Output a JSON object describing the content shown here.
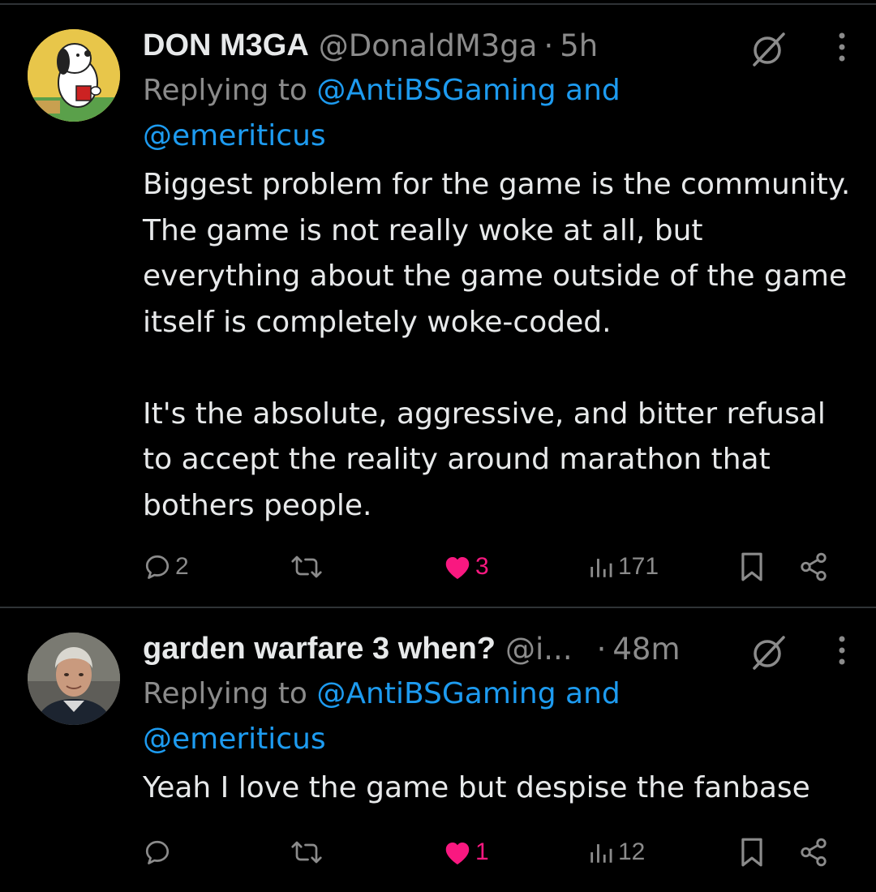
{
  "tweets": [
    {
      "name": "DON M3GA",
      "handle": "@DonaldM3ga",
      "separator": "·",
      "time": "5h",
      "reply_prefix": "Replying to ",
      "reply_mention_1": "@AntiBSGaming",
      "reply_and": " and",
      "reply_mention_2": "@emeriticus",
      "body": "Biggest problem for the game is the community. The game is not really woke at all, but everything about the game outside of the game itself is completely woke-coded.\n\nIt's the absolute, aggressive, and bitter refusal to accept the reality around marathon that bothers people.",
      "reply_count": "2",
      "retweet_count": "",
      "like_count": "3",
      "view_count": "171",
      "liked": true,
      "avatar_icon": "snoopy-avatar"
    },
    {
      "name": "garden warfare 3 when?",
      "handle": "@i...",
      "separator": "·",
      "time": "48m",
      "reply_prefix": "Replying to ",
      "reply_mention_1": "@AntiBSGaming",
      "reply_and": " and",
      "reply_mention_2": "@emeriticus",
      "body": "Yeah I love the game but despise the fanbase",
      "reply_count": "",
      "retweet_count": "",
      "like_count": "1",
      "view_count": "12",
      "liked": true,
      "avatar_icon": "person-photo-avatar"
    }
  ],
  "colors": {
    "background": "#000000",
    "text": "#e7e9ea",
    "muted": "#8b8b8b",
    "mention": "#1d9bf0",
    "like": "#f91880",
    "divider": "#2f3336"
  }
}
